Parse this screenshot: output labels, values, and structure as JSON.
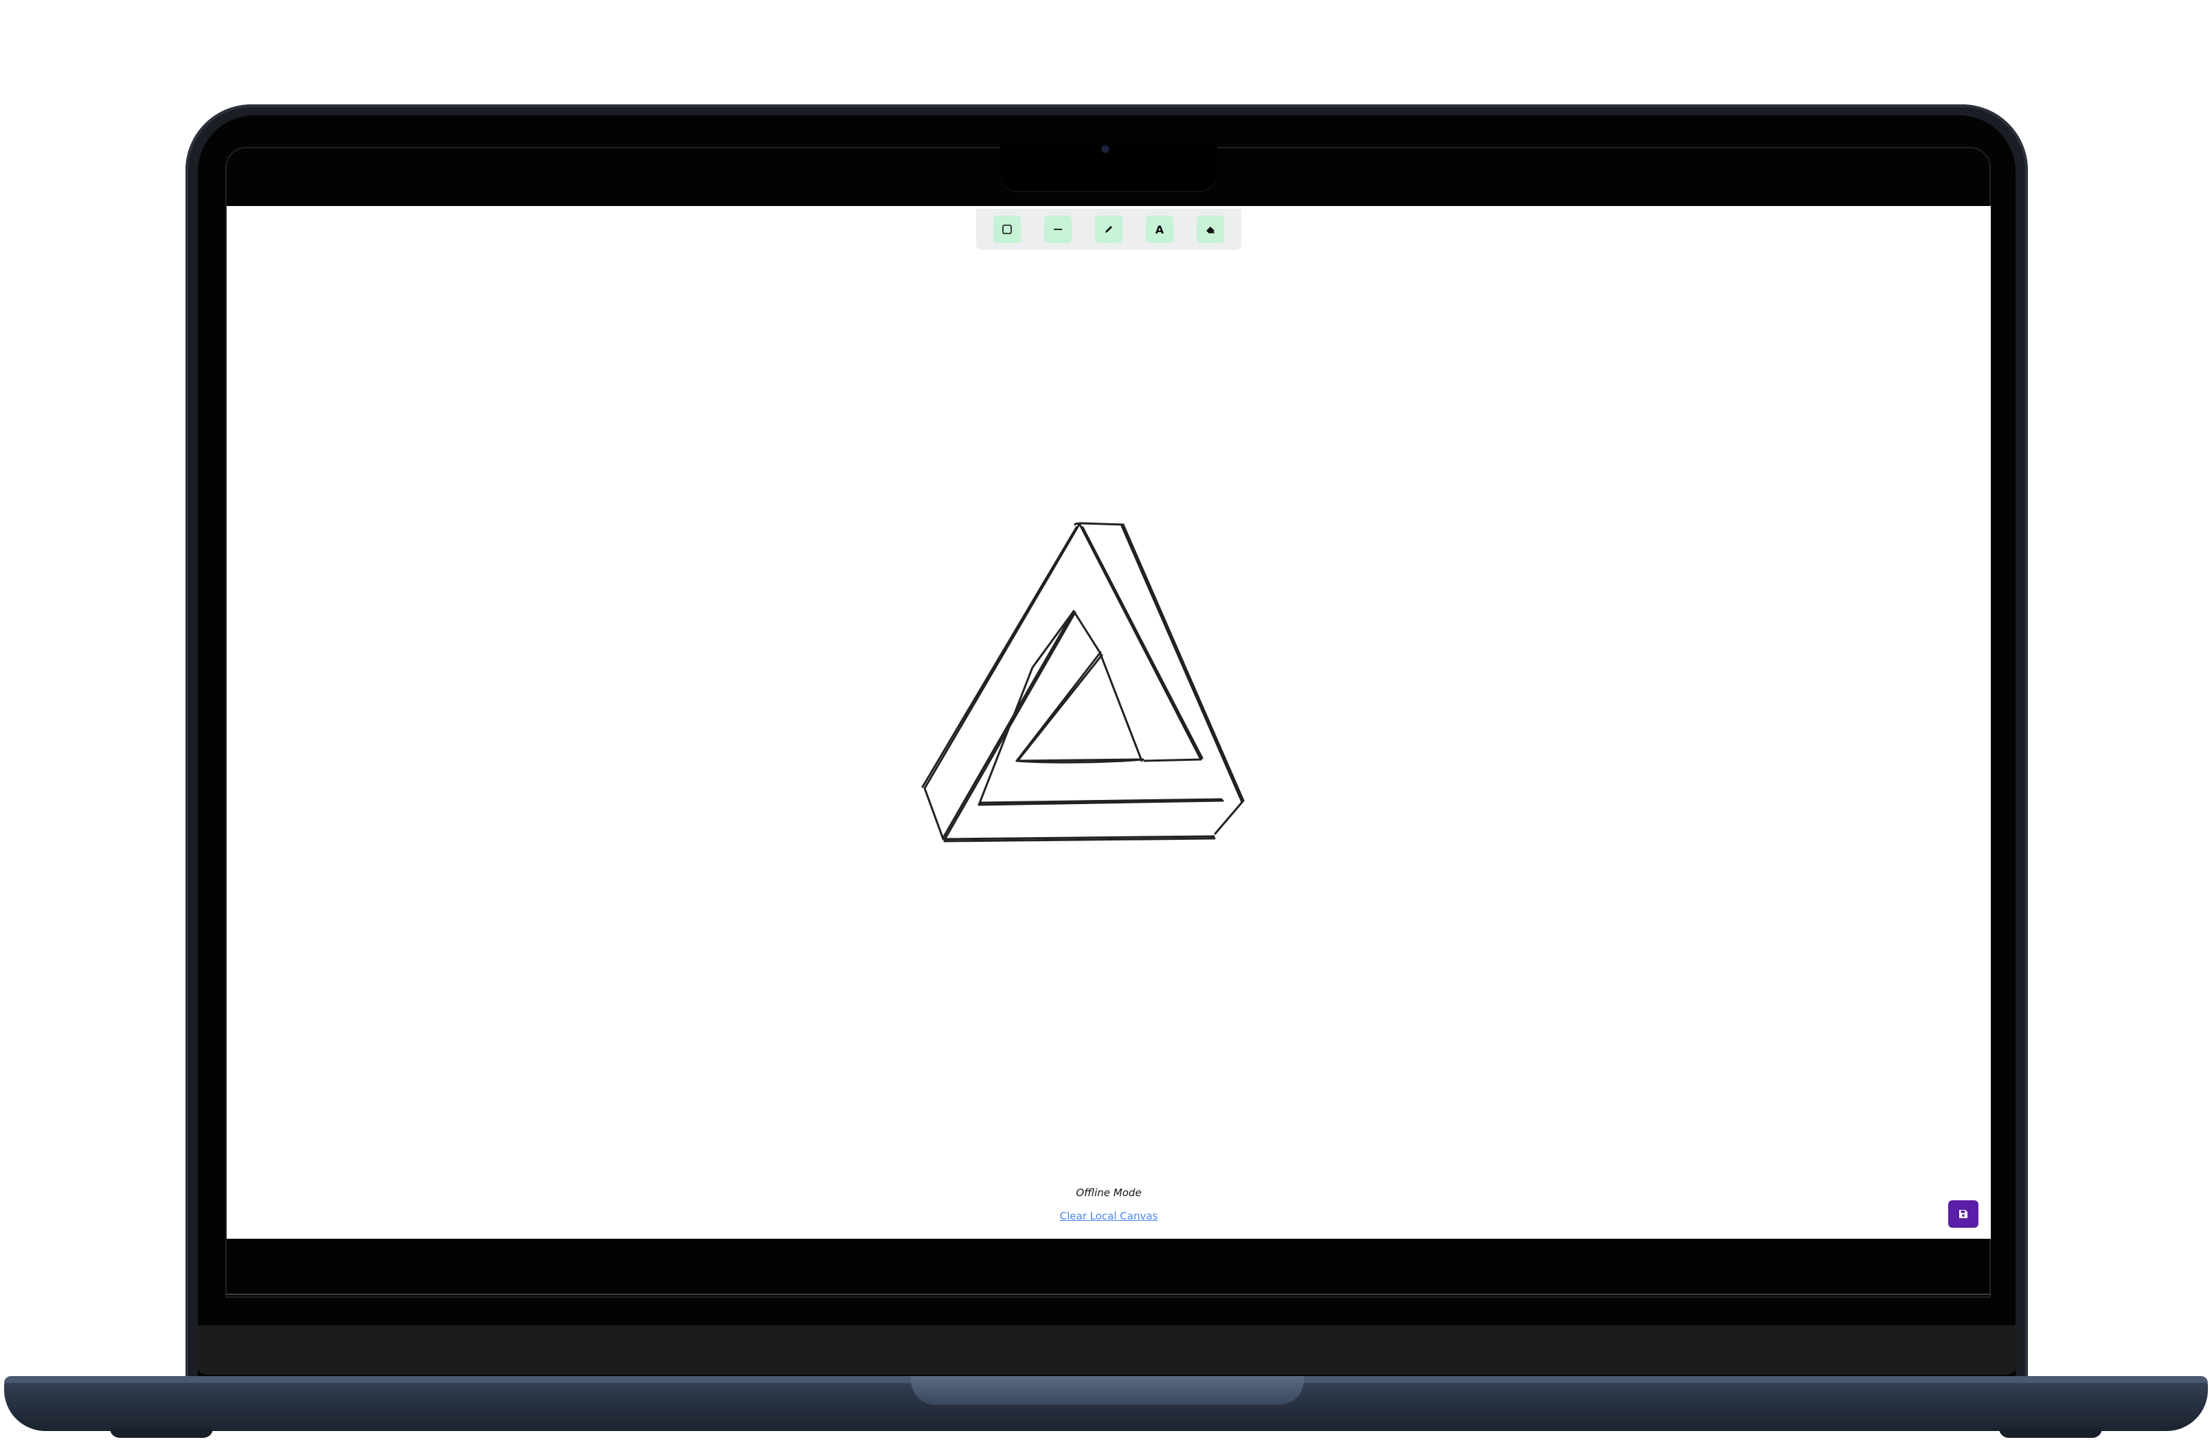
{
  "toolbar": {
    "tools": [
      {
        "icon": "square-icon",
        "label": "Rectangle"
      },
      {
        "icon": "line-icon",
        "label": "Line"
      },
      {
        "icon": "pencil-icon",
        "label": "Pencil"
      },
      {
        "icon": "text-icon",
        "label": "A"
      },
      {
        "icon": "eraser-icon",
        "label": "Eraser"
      }
    ]
  },
  "status": {
    "mode_label": "Offline Mode",
    "clear_link": "Clear Local Canvas"
  },
  "save_button": {
    "icon": "floppy-disk-icon"
  },
  "colors": {
    "tool_button_bg": "#c6f2d6",
    "toolbar_bg": "#eceeef",
    "save_button_bg": "#5b1ea6",
    "link_color": "#4a86e8",
    "stroke": "#222222"
  }
}
